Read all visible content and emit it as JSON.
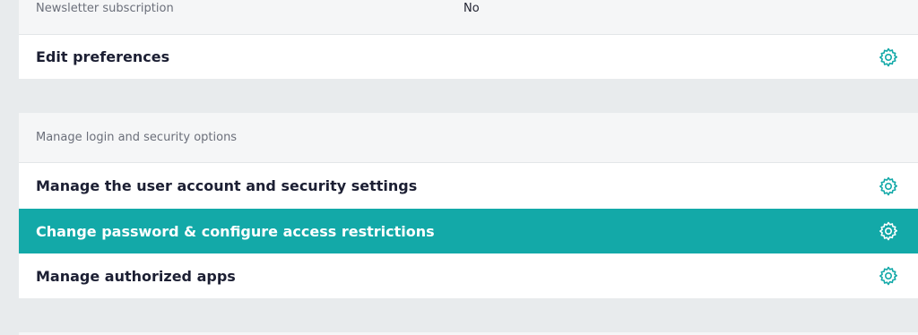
{
  "profile": {
    "newsletter_label": "Newsletter subscription",
    "newsletter_value": "No",
    "edit_preferences_label": "Edit preferences"
  },
  "security": {
    "header": "Manage login and security options",
    "items": [
      {
        "label": "Manage the user account and security settings",
        "active": false
      },
      {
        "label": "Change password & configure access restrictions",
        "active": true
      },
      {
        "label": "Manage authorized apps",
        "active": false
      }
    ]
  },
  "colors": {
    "accent": "#13a9a8",
    "background": "#e8ebed",
    "text": "#1c1f33"
  },
  "icons": {
    "row_action": "gear-icon"
  }
}
